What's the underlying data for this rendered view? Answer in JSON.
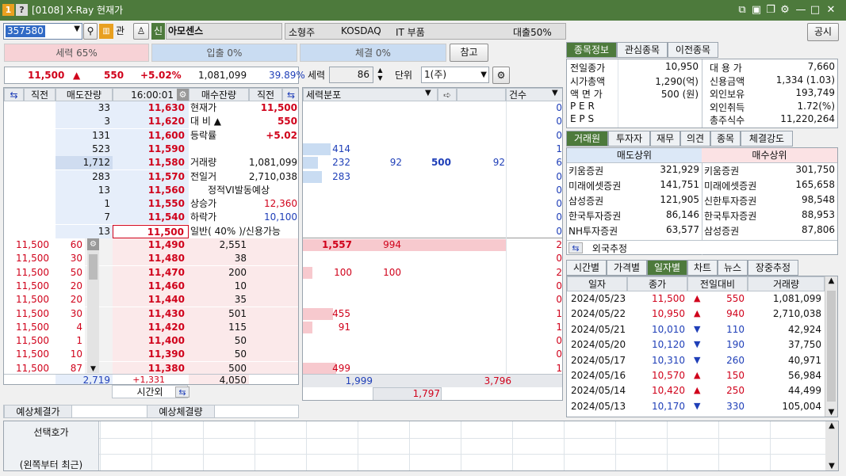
{
  "window": {
    "title": "[0108] X-Ray 현재가",
    "icons": [
      "1",
      "?"
    ],
    "controls": [
      "restore-icon",
      "camera-icon",
      "copy-icon",
      "gear-icon",
      "minimize-icon",
      "maximize-icon",
      "close-icon"
    ]
  },
  "toolbar": {
    "code": "357580",
    "kw": "관",
    "shin": "신",
    "name": "아모센스",
    "tags": [
      "소형주",
      "KOSDAQ",
      "IT 부품"
    ],
    "loan": "대출50%",
    "public": "공시"
  },
  "flows": {
    "power": "세력 65%",
    "inout": "입출 0%",
    "exec": "체결 0%",
    "ref": "참고"
  },
  "price_line": {
    "price": "11,500",
    "arrow": "▲",
    "change": "550",
    "rate": "+5.02%",
    "volume": "1,081,099",
    "ratio": "39.89%"
  },
  "ctrl": {
    "power_label": "세력",
    "power_val": "86",
    "unit_label": "단위",
    "unit_val": "1(주)"
  },
  "ob_headers": {
    "prev": "직전",
    "sell_rem": "매도잔량",
    "time": "16:00:01",
    "buy_rem": "매수잔량",
    "prev2": "직전"
  },
  "asks": [
    {
      "qty": "33",
      "price": "11,630"
    },
    {
      "qty": "3",
      "price": "11,620"
    },
    {
      "qty": "131",
      "price": "11,600"
    },
    {
      "qty": "523",
      "price": "11,590"
    },
    {
      "qty": "1,712",
      "price": "11,580"
    },
    {
      "qty": "283",
      "price": "11,570"
    },
    {
      "qty": "13",
      "price": "11,560"
    },
    {
      "qty": "1",
      "price": "11,550"
    },
    {
      "qty": "7",
      "price": "11,540"
    },
    {
      "qty": "13",
      "price": "11,500"
    }
  ],
  "info_rows": [
    {
      "k": "현재가",
      "v": "11,500"
    },
    {
      "k": "대  비  ▲",
      "v": "550"
    },
    {
      "k": "등락률",
      "v": "+5.02"
    },
    {
      "k": "",
      "v": ""
    },
    {
      "k": "거래량",
      "v": "1,081,099"
    },
    {
      "k": "전일거",
      "v": "2,710,038"
    },
    {
      "k": "정적VI발동예상",
      "v": ""
    },
    {
      "k": "상승가",
      "v": "12,360"
    },
    {
      "k": "하락가",
      "v": "10,100"
    },
    {
      "k": "일반( 40% )/신용가능",
      "v": ""
    }
  ],
  "bids": [
    {
      "prev": "11,500",
      "qty0": "60",
      "price": "11,490",
      "qty": "2,551"
    },
    {
      "prev": "11,500",
      "qty0": "30",
      "price": "11,480",
      "qty": "38"
    },
    {
      "prev": "11,500",
      "qty0": "50",
      "price": "11,470",
      "qty": "200"
    },
    {
      "prev": "11,500",
      "qty0": "20",
      "price": "11,460",
      "qty": "10"
    },
    {
      "prev": "11,500",
      "qty0": "20",
      "price": "11,440",
      "qty": "35"
    },
    {
      "prev": "11,500",
      "qty0": "30",
      "price": "11,430",
      "qty": "501"
    },
    {
      "prev": "11,500",
      "qty0": "4",
      "price": "11,420",
      "qty": "115"
    },
    {
      "prev": "11,500",
      "qty0": "1",
      "price": "11,400",
      "qty": "50"
    },
    {
      "prev": "11,500",
      "qty0": "10",
      "price": "11,390",
      "qty": "50"
    },
    {
      "prev": "11,500",
      "qty0": "87",
      "price": "11,380",
      "qty": "500"
    }
  ],
  "ob_totals": {
    "sell": "2,719",
    "diff": "+1,331",
    "buy": "4,050",
    "afterhours": "시간외"
  },
  "expect": {
    "price_label": "예상체결가",
    "qty_label": "예상체결량"
  },
  "dist": {
    "header": "세력분포",
    "count_header": "건수",
    "totals": {
      "left": "1,999",
      "right": "3,796",
      "center": "1,797"
    }
  },
  "dist_ask_rows": [
    "",
    "",
    "",
    "414",
    "232|92|500|92",
    "283",
    "",
    "",
    "",
    ""
  ],
  "dist_ask_counts": [
    "0",
    "0",
    "0",
    "1",
    "6",
    "0",
    "0",
    "0",
    "0",
    "0"
  ],
  "dist_bid_rows": [
    "1,557|994",
    "",
    "100|100",
    "",
    "",
    "455",
    "91",
    "",
    "",
    "499"
  ],
  "dist_bid_counts": [
    "2",
    "0",
    "2",
    "0",
    "0",
    "1",
    "1",
    "0",
    "0",
    "1"
  ],
  "info_tabs": [
    "종목정보",
    "관심종목",
    "이전종목"
  ],
  "info": {
    "left": [
      {
        "k": "전일종가",
        "v": "10,950"
      },
      {
        "k": "시가총액",
        "v": "1,290(억)"
      },
      {
        "k": "액 면 가",
        "v": "500 (원)"
      },
      {
        "k": "P E R",
        "v": ""
      },
      {
        "k": "E P S",
        "v": ""
      }
    ],
    "right": [
      {
        "k": "대 용 가",
        "v": "7,660"
      },
      {
        "k": "신용금액",
        "v": "1,334  (1.03)"
      },
      {
        "k": "외인보유",
        "v": "193,749"
      },
      {
        "k": "외인취득",
        "v": "1.72(%)"
      },
      {
        "k": "총주식수",
        "v": "11,220,264"
      }
    ]
  },
  "broker_tabs": [
    "거래원",
    "투자자",
    "재무",
    "의견",
    "종목",
    "체결강도"
  ],
  "brokers": {
    "sell_hdr": "매도상위",
    "buy_hdr": "매수상위",
    "foreign": "외국추정",
    "rows": [
      {
        "s": "키움증권",
        "sv": "321,929",
        "b": "키움증권",
        "bv": "301,750"
      },
      {
        "s": "미래에셋증권",
        "sv": "141,751",
        "b": "미래에셋증권",
        "bv": "165,658"
      },
      {
        "s": "삼성증권",
        "sv": "121,905",
        "b": "신한투자증권",
        "bv": "98,548"
      },
      {
        "s": "한국투자증권",
        "sv": "86,146",
        "b": "한국투자증권",
        "bv": "88,953"
      },
      {
        "s": "NH투자증권",
        "sv": "63,577",
        "b": "삼성증권",
        "bv": "87,806"
      }
    ]
  },
  "daily_tabs": [
    "시간별",
    "가격별",
    "일자별",
    "차트",
    "뉴스",
    "장중추정"
  ],
  "daily": {
    "headers": [
      "일자",
      "종가",
      "전일대비",
      "거래량"
    ],
    "rows": [
      {
        "d": "2024/05/23",
        "c": "11,500",
        "dir": "up",
        "v": "550",
        "q": "1,081,099"
      },
      {
        "d": "2024/05/22",
        "c": "10,950",
        "dir": "up",
        "v": "940",
        "q": "2,710,038"
      },
      {
        "d": "2024/05/21",
        "c": "10,010",
        "dir": "down",
        "v": "110",
        "q": "42,924"
      },
      {
        "d": "2024/05/20",
        "c": "10,120",
        "dir": "down",
        "v": "190",
        "q": "37,750"
      },
      {
        "d": "2024/05/17",
        "c": "10,310",
        "dir": "down",
        "v": "260",
        "q": "40,971"
      },
      {
        "d": "2024/05/16",
        "c": "10,570",
        "dir": "up",
        "v": "150",
        "q": "56,984"
      },
      {
        "d": "2024/05/14",
        "c": "10,420",
        "dir": "up",
        "v": "250",
        "q": "44,499"
      },
      {
        "d": "2024/05/13",
        "c": "10,170",
        "dir": "down",
        "v": "330",
        "q": "105,004"
      }
    ]
  },
  "bottom": {
    "label1": "선택호가",
    "label2": "(왼쪽부터 최근)"
  },
  "colors": {
    "title": "#4d7a3c",
    "up": "#d0021b",
    "down": "#1f3fb8",
    "ask_bg": "#e6eefa",
    "bid_bg": "#fbe9ea"
  }
}
